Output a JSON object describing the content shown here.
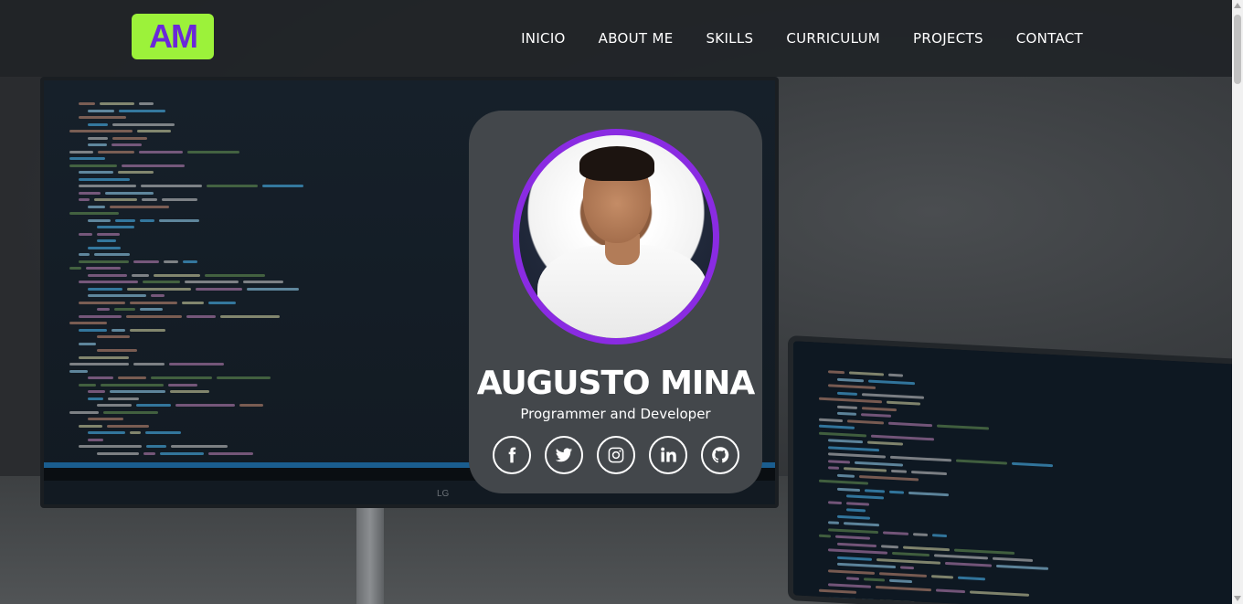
{
  "logo": {
    "text": "AM",
    "bg_color": "#9cf23a",
    "fg_color": "#6a28d9"
  },
  "nav": {
    "items": [
      {
        "label": "INICIO"
      },
      {
        "label": "ABOUT ME"
      },
      {
        "label": "SKILLS"
      },
      {
        "label": "CURRICULUM"
      },
      {
        "label": "PROJECTS"
      },
      {
        "label": "CONTACT"
      }
    ]
  },
  "hero": {
    "monitor_brand": "LG"
  },
  "profile": {
    "name": "AUGUSTO MINA",
    "role": "Programmer and Developer",
    "avatar_ring_color": "#8a2be2",
    "card_color": "#43474b",
    "socials": [
      {
        "icon": "facebook-icon"
      },
      {
        "icon": "twitter-icon"
      },
      {
        "icon": "instagram-icon"
      },
      {
        "icon": "linkedin-icon"
      },
      {
        "icon": "github-icon"
      }
    ]
  }
}
